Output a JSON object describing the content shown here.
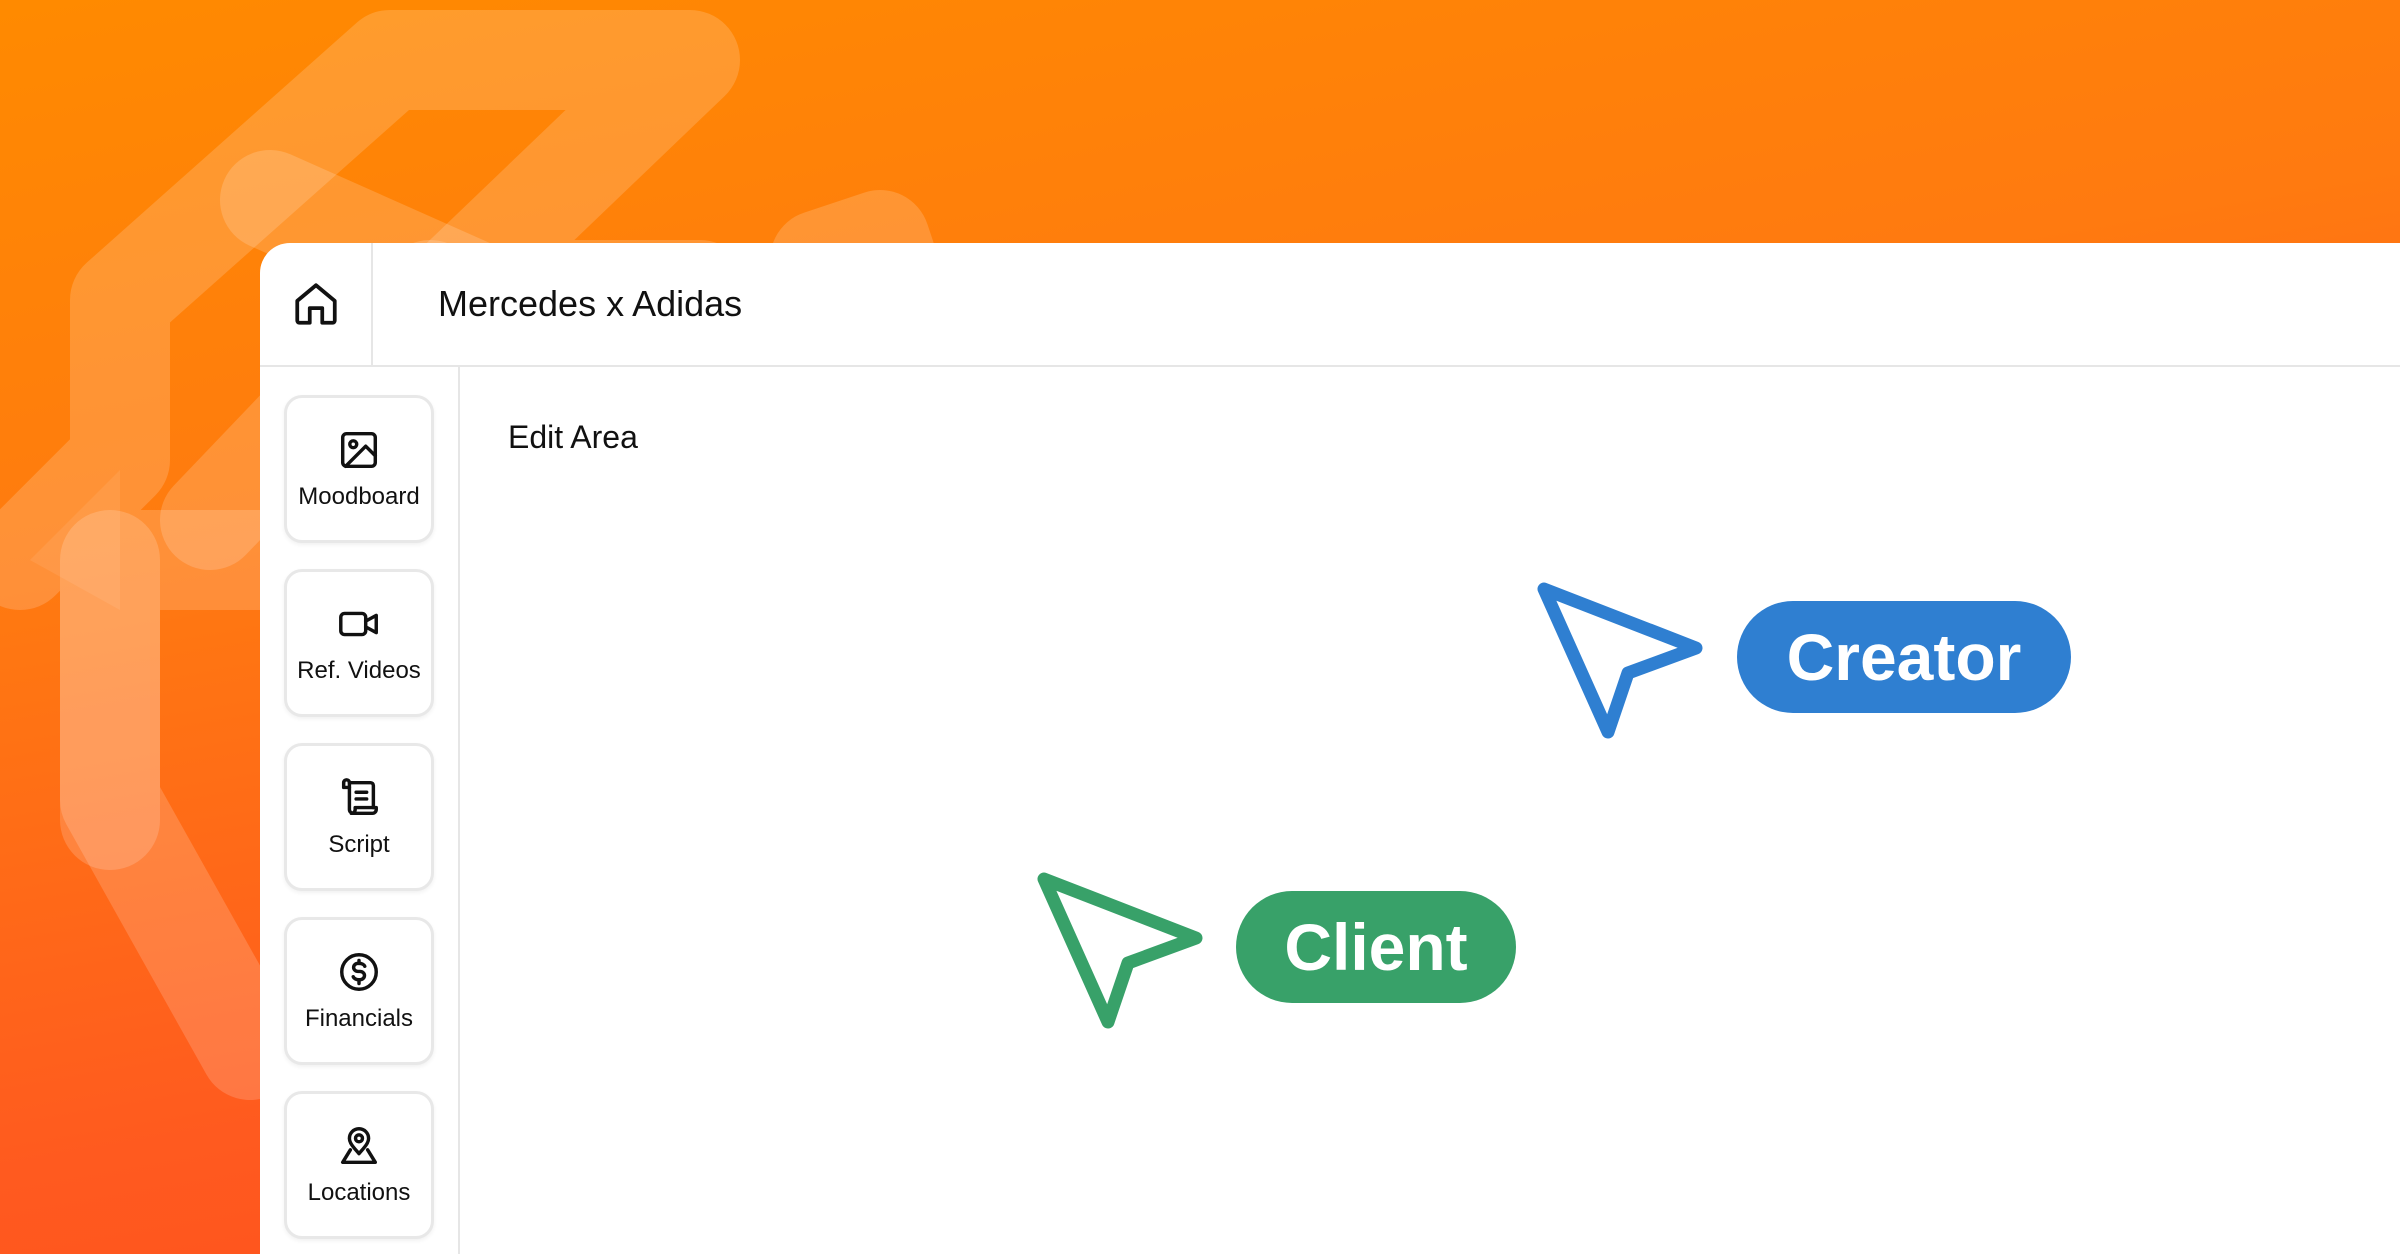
{
  "header": {
    "title": "Mercedes x Adidas",
    "home_icon": "home-icon"
  },
  "sidebar": {
    "items": [
      {
        "label": "Moodboard",
        "icon": "image-icon"
      },
      {
        "label": "Ref. Videos",
        "icon": "video-camera-icon"
      },
      {
        "label": "Script",
        "icon": "script-scroll-icon"
      },
      {
        "label": "Financials",
        "icon": "dollar-circle-icon"
      },
      {
        "label": "Locations",
        "icon": "map-pin-icon"
      }
    ]
  },
  "main": {
    "edit_area_label": "Edit Area"
  },
  "cursors": {
    "creator": {
      "label": "Creator",
      "color": "#2f7fd1"
    },
    "client": {
      "label": "Client",
      "color": "#38a169"
    }
  },
  "colors": {
    "background_top": "#ff8a00",
    "background_bottom": "#ff4a1c"
  }
}
